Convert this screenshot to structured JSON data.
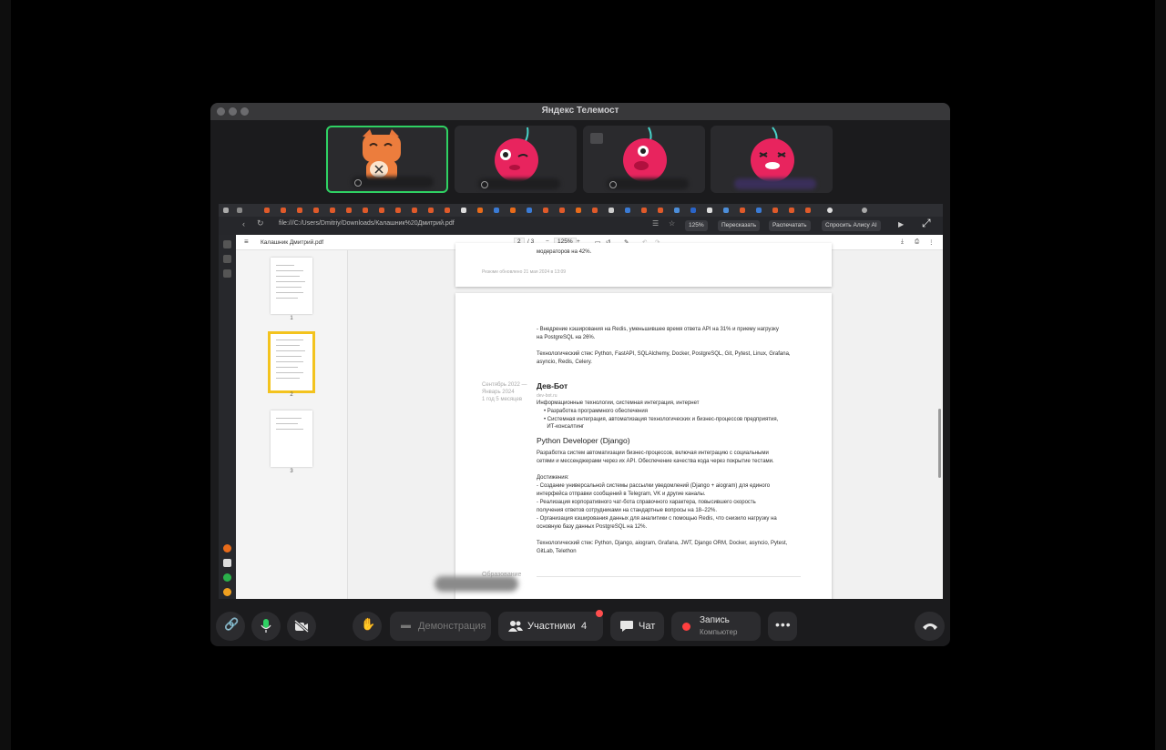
{
  "window": {
    "title": "Яндекс Телемост"
  },
  "participants_tiles": [
    {
      "avatar": "fox-sticker",
      "active": true
    },
    {
      "avatar": "cherry-sticker",
      "active": false
    },
    {
      "avatar": "cherry-sticker",
      "active": false
    },
    {
      "avatar": "cherry-sticker",
      "active": false
    }
  ],
  "browser": {
    "address": "file:///C:/Users/Dmitriy/Downloads/Калашник%20Дмитрий.pdf",
    "zoom": "125%",
    "buttons": [
      "Пересказать",
      "Распечатать",
      "Спросить Алису AI"
    ]
  },
  "pdf": {
    "filename": "Калашник Дмитрий.pdf",
    "page_current": "2",
    "page_total": "/ 3",
    "zoom": "125%",
    "thumbnails": [
      "1",
      "2",
      "3"
    ],
    "page1_tail": {
      "line": "модераторов на 42%.",
      "footer": "Резюме обновлено 21 мая 2024 в 13:09"
    },
    "page2": {
      "intro": [
        "- Внедрение кэширования на Redis, уменьшившее время ответа API на 31% и приему нагрузку",
        "на PostgreSQL на 26%."
      ],
      "stack1": [
        "Технологический стек: Python, FastAPI, SQLAlchemy, Docker, PostgreSQL, Git, Pytest, Linux, Grafana,",
        "asyncio, Redis, Celery."
      ],
      "period": [
        "Сентябрь 2022 —",
        "Январь 2024",
        "1 год 5 месяцев"
      ],
      "company": "Дев-Бот",
      "company_site": "dev-bot.ru",
      "industry": "Информационные технологии, системная интеграция, интернет",
      "bullets": [
        "• Разработка программного обеспечения",
        "• Системная интеграция, автоматизация технологических и бизнес-процессов предприятия,",
        "  ИТ-консалтинг"
      ],
      "position": "Python Developer (Django)",
      "description": [
        "Разработка систем автоматизации бизнес-процессов, включая интеграцию с социальными",
        "сетями и мессенджерами через их API. Обеспечение качества кода через покрытие тестами."
      ],
      "achievements_title": "Достижения:",
      "achievements": [
        "- Создание универсальной системы рассылки уведомлений (Django + aiogram) для единого",
        "интерфейса отправки сообщений в Telegram, VK и другие каналы.",
        "- Реализация корпоративного чат-бота справочного характера, повысившего скорость",
        "получения ответов сотрудниками на стандартные вопросы на 18–22%.",
        "- Организация кэширования данных для аналитики с помощью Redis, что снизило нагрузку на",
        "основную базу данных PostgreSQL на 12%."
      ],
      "stack2": [
        "Технологический стек: Python, Django, aiogram, Grafana, JWT, Django ORM, Docker, asyncio, Pytest,",
        "GitLab, Telethon"
      ],
      "education": "Образование"
    }
  },
  "toolbar": {
    "demo": "Демонстрация",
    "participants": "Участники",
    "participants_count": "4",
    "chat": "Чат",
    "record": "Запись",
    "record_sub": "Компьютер"
  },
  "colors": {
    "accent_green": "#2fd163",
    "record_red": "#ff3f3f",
    "selected_thumb": "#f3c31e"
  }
}
